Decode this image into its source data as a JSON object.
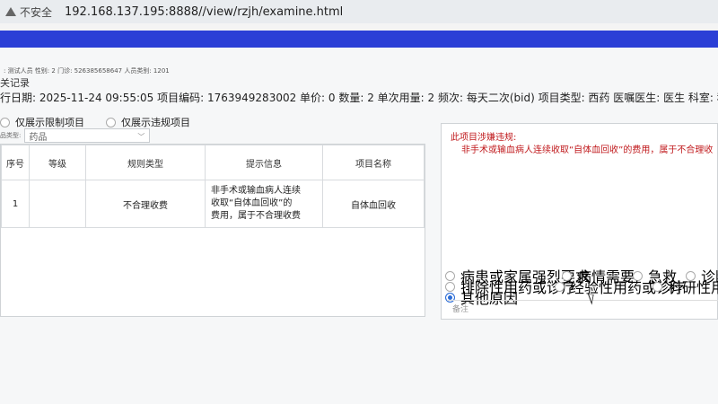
{
  "browser": {
    "security_label": "不安全",
    "url": "192.168.137.195:8888//view/rzjh/examine.html"
  },
  "patient_info": ": 测试人员 性别: 2 门诊: 526385658647 人员类别: 1201",
  "section_title": "关记录",
  "record_detail": "行日期: 2025-11-24 09:55:05 项目编码: 1763949283002 单价: 0 数量: 2 单次用量: 2 频次: 每天二次(bid) 项目类型: 西药 医嘱医生: 医生 科室: 科室",
  "view_options": [
    "仅展示限制项目",
    "仅展示违规项目"
  ],
  "filter": {
    "label": "品类型:",
    "value": "药品"
  },
  "table": {
    "headers": [
      "序号",
      "等级",
      "规则类型",
      "提示信息",
      "项目名称"
    ],
    "rows": [
      {
        "index": "1",
        "level": "",
        "rule_type": "不合理收费",
        "message_lines": [
          "非手术或输血病人连续",
          "收取“自体血回收”的",
          "费用，属于不合理收费"
        ],
        "item_name": "自体血回收"
      }
    ]
  },
  "violation": {
    "title": "此项目涉嫌违规:",
    "text": "非手术或输血病人连续收取“自体血回收”的费用，属于不合理收"
  },
  "reasons": {
    "options": [
      {
        "label": "病患或家属强烈要求",
        "selected": false
      },
      {
        "label": "病情需要",
        "selected": false
      },
      {
        "label": "急救",
        "selected": false
      },
      {
        "label": "诊断",
        "selected": false
      },
      {
        "label": "排除性用药或诊疗",
        "selected": false
      },
      {
        "label": "经验性用药或诊疗",
        "selected": false
      },
      {
        "label": "科研性用药",
        "selected": false
      },
      {
        "label": "其他原因",
        "selected": true
      }
    ]
  },
  "notes_placeholder": "备注",
  "colors": {
    "accent_blue": "#2b3fd6",
    "violation_red": "#c0191c"
  }
}
